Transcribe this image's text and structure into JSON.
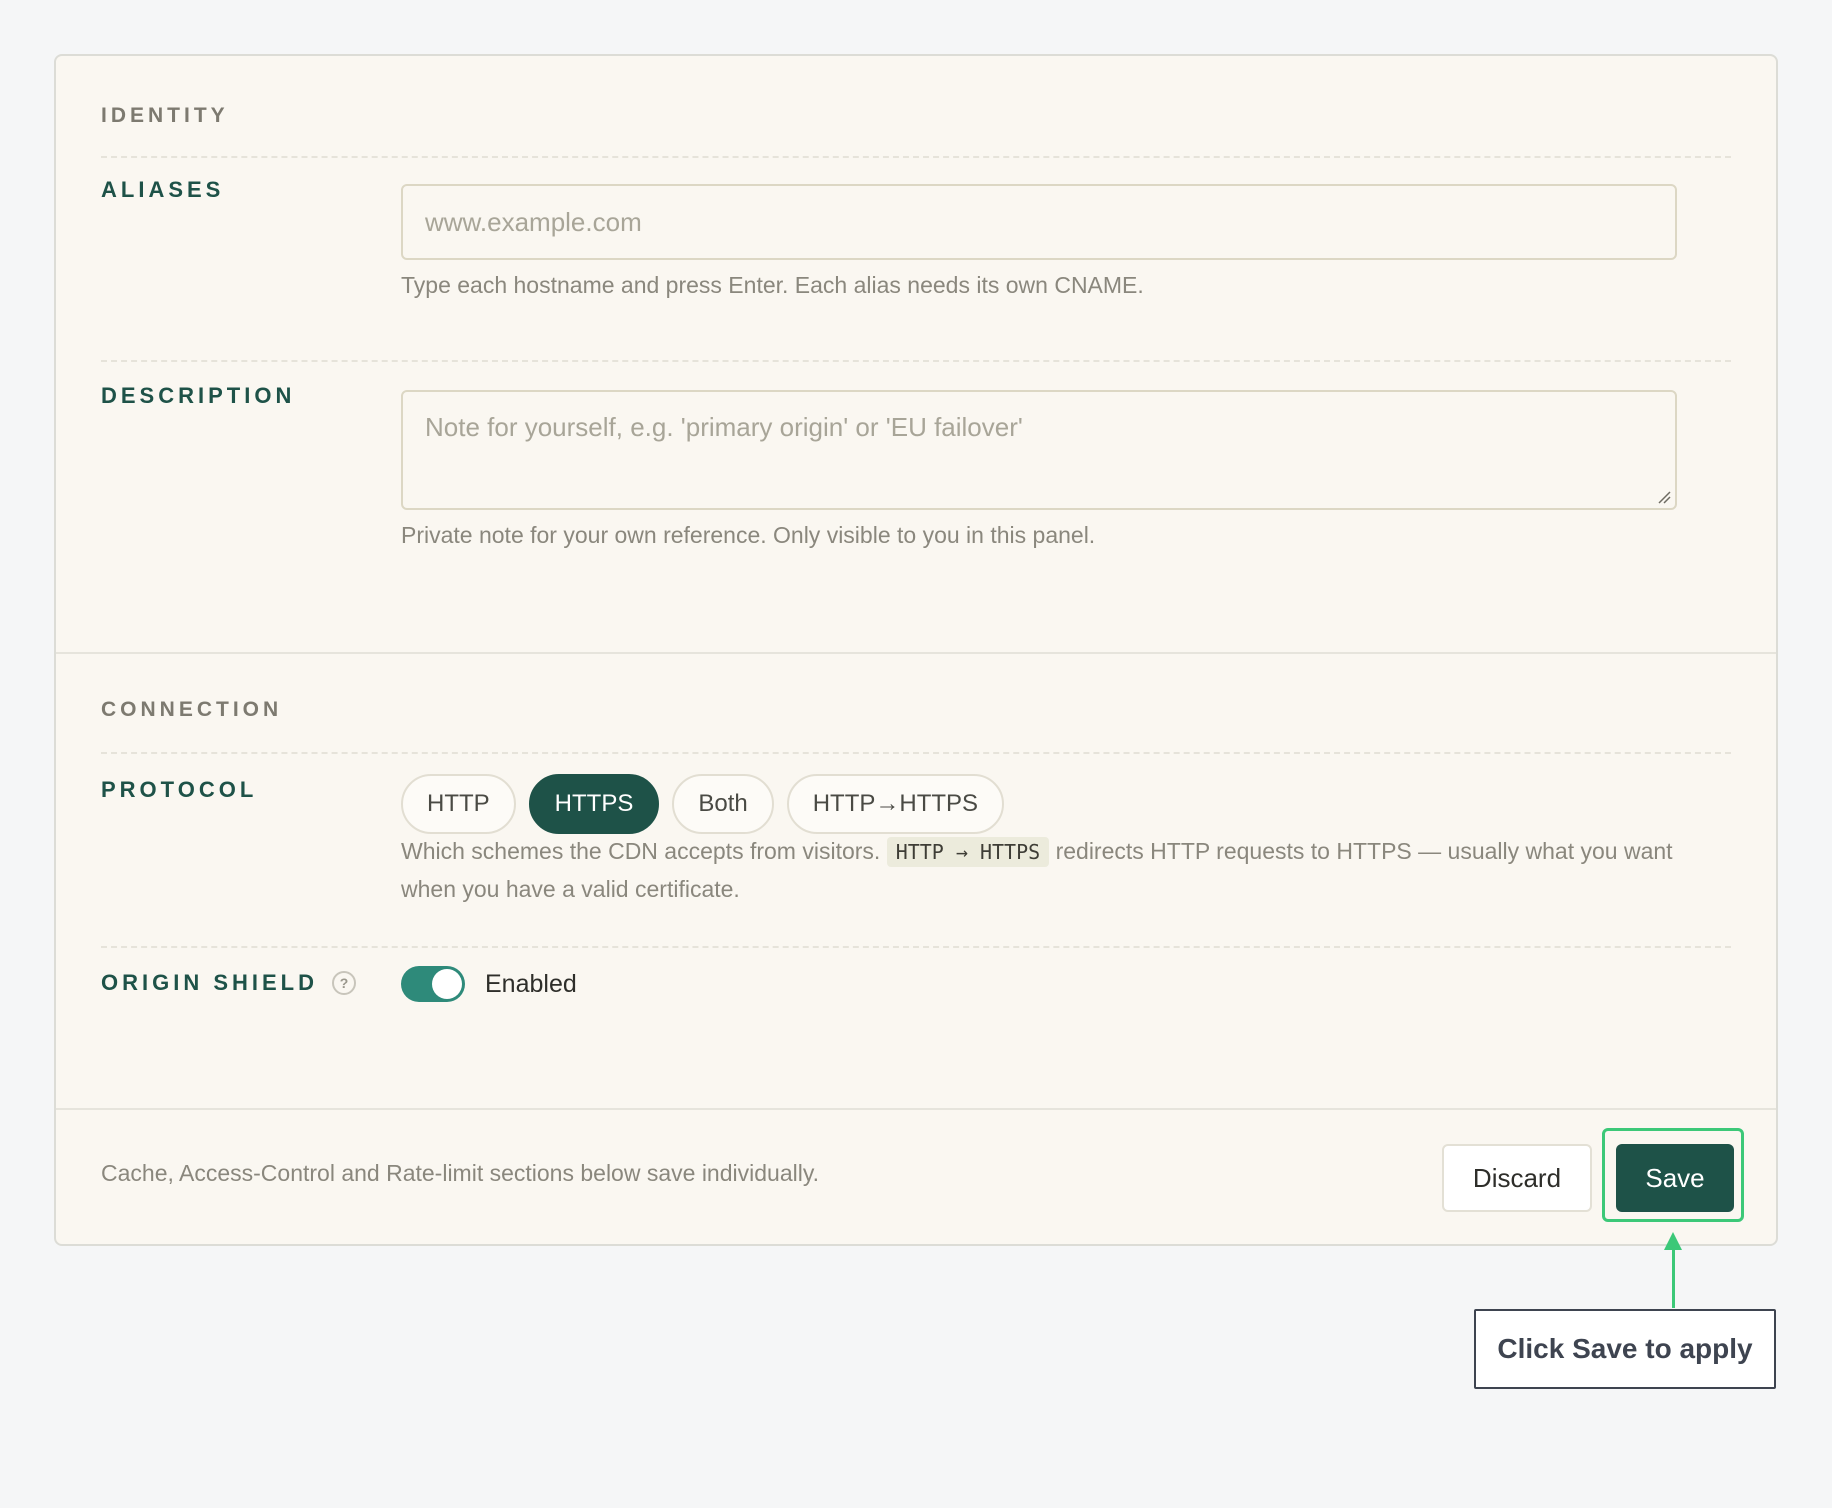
{
  "identity": {
    "title": "IDENTITY",
    "aliases": {
      "label": "ALIASES",
      "placeholder": "www.example.com",
      "hint": "Type each hostname and press Enter. Each alias needs its own CNAME."
    },
    "description": {
      "label": "DESCRIPTION",
      "placeholder": "Note for yourself, e.g. 'primary origin' or 'EU failover'",
      "hint": "Private note for your own reference. Only visible to you in this panel."
    }
  },
  "connection": {
    "title": "CONNECTION",
    "protocol": {
      "label": "PROTOCOL",
      "options": [
        "HTTP",
        "HTTPS",
        "Both",
        "HTTP→HTTPS"
      ],
      "selected": "HTTPS",
      "hint_before": "Which schemes the CDN accepts from visitors.",
      "hint_code": "HTTP → HTTPS",
      "hint_after": "redirects HTTP requests to HTTPS — usually what you want when you have a valid certificate."
    },
    "origin_shield": {
      "label": "ORIGIN SHIELD",
      "help_icon": "?",
      "enabled": true,
      "state_label": "Enabled"
    }
  },
  "footer": {
    "note": "Cache, Access-Control and Rate-limit sections below save individually.",
    "discard_label": "Discard",
    "save_label": "Save"
  },
  "annotation": {
    "callout_text": "Click Save to apply",
    "highlight_color": "#3cc878"
  },
  "colors": {
    "accent": "#1e5248",
    "toggle_on": "#2e8a7a",
    "panel_bg": "#faf7f1",
    "page_bg": "#f5f6f7"
  }
}
